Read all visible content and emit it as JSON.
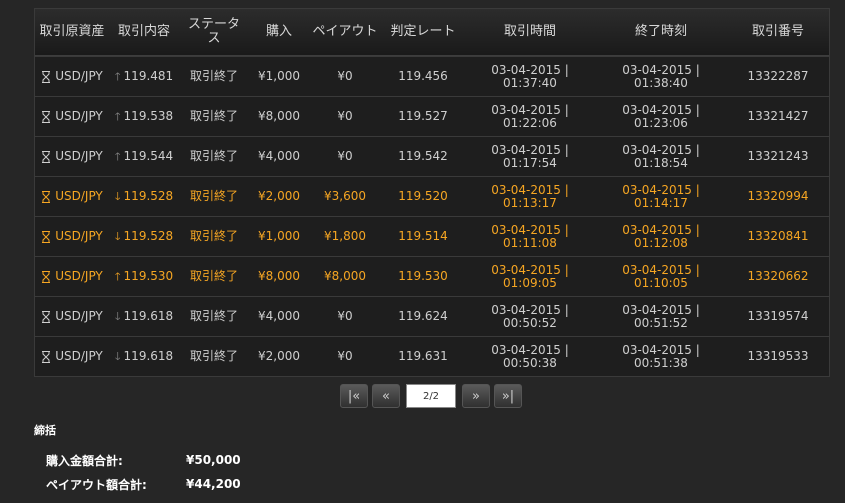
{
  "table": {
    "headers": [
      "取引原資産",
      "取引内容",
      "ステータス",
      "購入",
      "ペイアウト",
      "判定レート",
      "取引時間",
      "終了時刻",
      "取引番号"
    ],
    "rows": [
      {
        "asset": "USD/JPY",
        "dir": "up",
        "rate": "119.481",
        "status": "取引終了",
        "purchase": "¥1,000",
        "payout": "¥0",
        "judge": "119.456",
        "start_date": "03-04-2015 |",
        "start_time": "01:37:40",
        "end_date": "03-04-2015 |",
        "end_time": "01:38:40",
        "id": "13322287",
        "win": false
      },
      {
        "asset": "USD/JPY",
        "dir": "up",
        "rate": "119.538",
        "status": "取引終了",
        "purchase": "¥8,000",
        "payout": "¥0",
        "judge": "119.527",
        "start_date": "03-04-2015 |",
        "start_time": "01:22:06",
        "end_date": "03-04-2015 |",
        "end_time": "01:23:06",
        "id": "13321427",
        "win": false
      },
      {
        "asset": "USD/JPY",
        "dir": "up",
        "rate": "119.544",
        "status": "取引終了",
        "purchase": "¥4,000",
        "payout": "¥0",
        "judge": "119.542",
        "start_date": "03-04-2015 |",
        "start_time": "01:17:54",
        "end_date": "03-04-2015 |",
        "end_time": "01:18:54",
        "id": "13321243",
        "win": false
      },
      {
        "asset": "USD/JPY",
        "dir": "down",
        "rate": "119.528",
        "status": "取引終了",
        "purchase": "¥2,000",
        "payout": "¥3,600",
        "judge": "119.520",
        "start_date": "03-04-2015 |",
        "start_time": "01:13:17",
        "end_date": "03-04-2015 |",
        "end_time": "01:14:17",
        "id": "13320994",
        "win": true
      },
      {
        "asset": "USD/JPY",
        "dir": "down",
        "rate": "119.528",
        "status": "取引終了",
        "purchase": "¥1,000",
        "payout": "¥1,800",
        "judge": "119.514",
        "start_date": "03-04-2015 |",
        "start_time": "01:11:08",
        "end_date": "03-04-2015 |",
        "end_time": "01:12:08",
        "id": "13320841",
        "win": true
      },
      {
        "asset": "USD/JPY",
        "dir": "up",
        "rate": "119.530",
        "status": "取引終了",
        "purchase": "¥8,000",
        "payout": "¥8,000",
        "judge": "119.530",
        "start_date": "03-04-2015 |",
        "start_time": "01:09:05",
        "end_date": "03-04-2015 |",
        "end_time": "01:10:05",
        "id": "13320662",
        "win": true
      },
      {
        "asset": "USD/JPY",
        "dir": "down",
        "rate": "119.618",
        "status": "取引終了",
        "purchase": "¥4,000",
        "payout": "¥0",
        "judge": "119.624",
        "start_date": "03-04-2015 |",
        "start_time": "00:50:52",
        "end_date": "03-04-2015 |",
        "end_time": "00:51:52",
        "id": "13319574",
        "win": false
      },
      {
        "asset": "USD/JPY",
        "dir": "down",
        "rate": "119.618",
        "status": "取引終了",
        "purchase": "¥2,000",
        "payout": "¥0",
        "judge": "119.631",
        "start_date": "03-04-2015 |",
        "start_time": "00:50:38",
        "end_date": "03-04-2015 |",
        "end_time": "00:51:38",
        "id": "13319533",
        "win": false
      }
    ]
  },
  "pager": {
    "page": "2/2",
    "first": "|«",
    "prev": "«",
    "next": "»",
    "last": "»|"
  },
  "summary": {
    "title": "締括",
    "purchase_label": "購入金額合計:",
    "purchase_value": "¥50,000",
    "payout_label": "ペイアウト額合計:",
    "payout_value": "¥44,200"
  },
  "icons": {
    "asset": "hourglass-icon",
    "up": "arrow-up-icon",
    "down": "arrow-down-icon"
  },
  "colors": {
    "win": "#f6a623",
    "text": "#cfcfcf",
    "bg": "#262626"
  }
}
